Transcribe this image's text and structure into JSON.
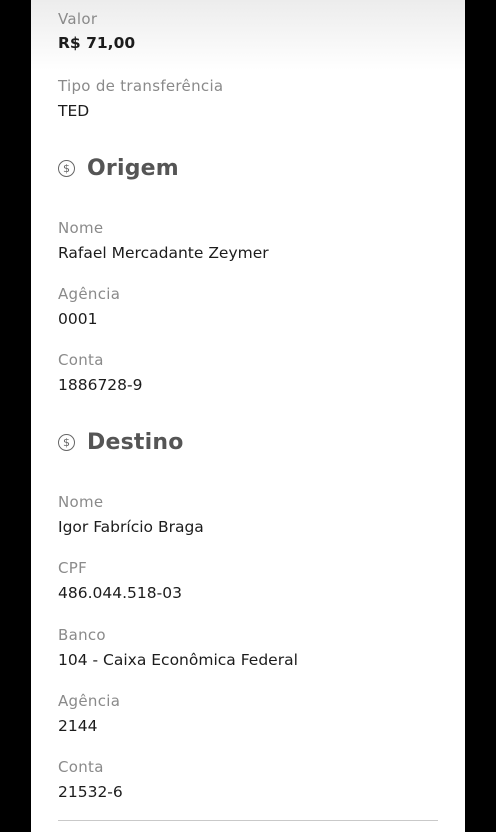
{
  "transfer": {
    "valor_label": "Valor",
    "valor_value": "R$ 71,00",
    "tipo_label": "Tipo de transferência",
    "tipo_value": "TED"
  },
  "origem": {
    "title": "Origem",
    "icon": "dollar-circle-icon",
    "nome_label": "Nome",
    "nome_value": "Rafael Mercadante Zeymer",
    "agencia_label": "Agência",
    "agencia_value": "0001",
    "conta_label": "Conta",
    "conta_value": "1886728-9"
  },
  "destino": {
    "title": "Destino",
    "icon": "dollar-circle-icon",
    "nome_label": "Nome",
    "nome_value": "Igor Fabrício Braga",
    "cpf_label": "CPF",
    "cpf_value": "486.044.518-03",
    "banco_label": "Banco",
    "banco_value": "104 - Caixa Econômica Federal",
    "agencia_label": "Agência",
    "agencia_value": "2144",
    "conta_label": "Conta",
    "conta_value": "21532-6"
  }
}
